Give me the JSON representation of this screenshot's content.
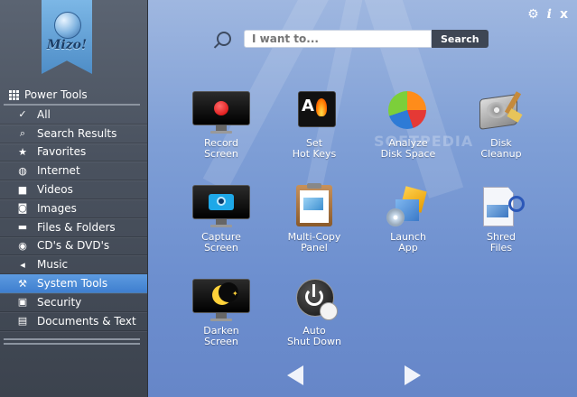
{
  "app": {
    "logo_text": "Mizo!"
  },
  "top_icons": {
    "settings": "⚙",
    "info": "i",
    "close": "x"
  },
  "search": {
    "placeholder": "I want to...",
    "button_label": "Search"
  },
  "sidebar": {
    "section_title": "Power Tools",
    "items": [
      {
        "label": "All",
        "icon": "check-icon",
        "glyph": "✓"
      },
      {
        "label": "Search Results",
        "icon": "search-icon",
        "glyph": "⌕"
      },
      {
        "label": "Favorites",
        "icon": "star-icon",
        "glyph": "★"
      },
      {
        "label": "Internet",
        "icon": "globe-icon",
        "glyph": "◍"
      },
      {
        "label": "Videos",
        "icon": "video-camera-icon",
        "glyph": "■"
      },
      {
        "label": "Images",
        "icon": "camera-icon",
        "glyph": "◙"
      },
      {
        "label": "Files & Folders",
        "icon": "folder-icon",
        "glyph": "▬"
      },
      {
        "label": "CD's & DVD's",
        "icon": "disc-icon",
        "glyph": "◉"
      },
      {
        "label": "Music",
        "icon": "speaker-icon",
        "glyph": "◂"
      },
      {
        "label": "System Tools",
        "icon": "wrench-icon",
        "glyph": "⚒"
      },
      {
        "label": "Security",
        "icon": "lock-icon",
        "glyph": "▣"
      },
      {
        "label": "Documents & Text",
        "icon": "document-icon",
        "glyph": "▤"
      }
    ],
    "active_index": 9
  },
  "tools": [
    {
      "line1": "Record",
      "line2": "Screen",
      "icon": "record-screen-icon"
    },
    {
      "line1": "Set",
      "line2": "Hot Keys",
      "icon": "hot-keys-icon"
    },
    {
      "line1": "Analyze",
      "line2": "Disk Space",
      "icon": "pie-chart-icon"
    },
    {
      "line1": "Disk",
      "line2": "Cleanup",
      "icon": "disk-cleanup-icon"
    },
    {
      "line1": "Capture",
      "line2": "Screen",
      "icon": "capture-screen-icon"
    },
    {
      "line1": "Multi-Copy",
      "line2": "Panel",
      "icon": "clipboard-icon"
    },
    {
      "line1": "Launch",
      "line2": "App",
      "icon": "launch-app-icon"
    },
    {
      "line1": "Shred",
      "line2": "Files",
      "icon": "shred-files-icon"
    },
    {
      "line1": "Darken",
      "line2": "Screen",
      "icon": "darken-screen-icon"
    },
    {
      "line1": "Auto",
      "line2": "Shut Down",
      "icon": "power-icon"
    }
  ],
  "watermark": "SOFTPEDIA",
  "colors": {
    "accent": "#4a8ad8",
    "sidebar": "#4a525f",
    "main_bg": "#7f9fd6"
  }
}
